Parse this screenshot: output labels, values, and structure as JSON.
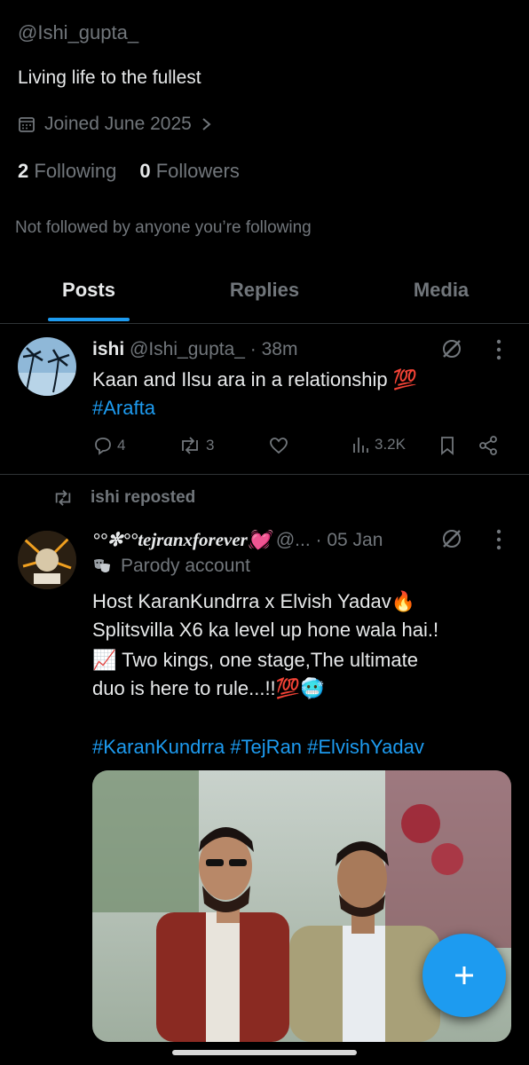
{
  "profile": {
    "handle": "@Ishi_gupta_",
    "bio": "Living life to the fullest",
    "joined": "Joined June 2025",
    "following_count": "2",
    "following_label": "Following",
    "followers_count": "0",
    "followers_label": "Followers",
    "not_followed": "Not followed by anyone you’re following"
  },
  "tabs": [
    {
      "label": "Posts",
      "active": true
    },
    {
      "label": "Replies",
      "active": false
    },
    {
      "label": "Media",
      "active": false
    }
  ],
  "post1": {
    "name": "ishi",
    "handle": "@Ishi_gupta_",
    "time": "· 38m",
    "text": "Kaan and Ilsu ara in a relationship 💯",
    "hashtag": "#Arafta",
    "replies": "4",
    "reposts": "3",
    "views": "3.2K"
  },
  "repost_label": "ishi reposted",
  "post2": {
    "name": "°°✼°°tejranxforever💓",
    "handle": "@...",
    "time": "· 05 Jan",
    "parody_label": "Parody account",
    "text_line1": "Host KaranKundrra x Elvish Yadav🔥",
    "text_line2": "Splitsvilla X6 ka level up hone wala hai.!",
    "text_line3": "📈 Two kings, one stage,The ultimate",
    "text_line4": "duo is here to rule...!!💯🥶",
    "hashtags": "#KaranKundrra #TejRan #ElvishYadav"
  },
  "colors": {
    "accent": "#1d9bf0",
    "muted": "#71767b",
    "text": "#e7e9ea",
    "background": "#000000"
  }
}
